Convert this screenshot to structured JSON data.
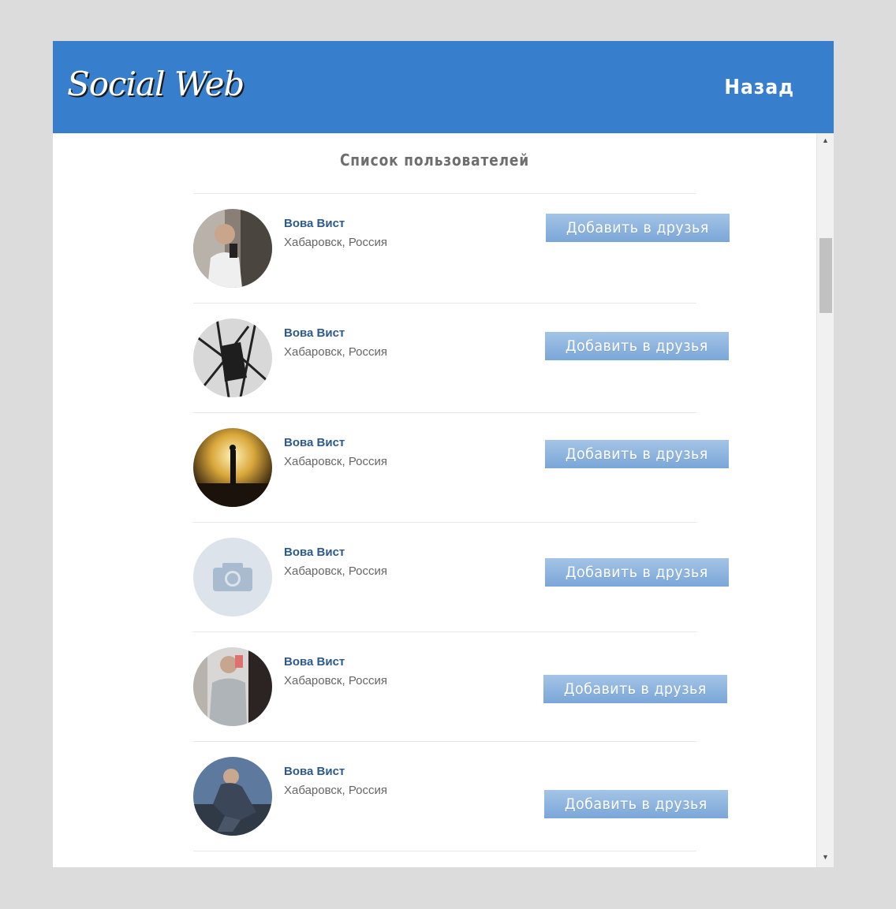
{
  "header": {
    "logo": "Social Web",
    "back_label": "Назад",
    "color": "#377ecc"
  },
  "page": {
    "title": "Список пользователей"
  },
  "users": [
    {
      "name": "Вова Вист",
      "location": "Хабаровск, Россия",
      "button_label": "Добавить в друзья",
      "avatar": "photo-man-mirror-selfie"
    },
    {
      "name": "Вова Вист",
      "location": "Хабаровск, Россия",
      "button_label": "Добавить в друзья",
      "avatar": "photo-dark-branches"
    },
    {
      "name": "Вова Вист",
      "location": "Хабаровск, Россия",
      "button_label": "Добавить в друзья",
      "avatar": "photo-silhouette-sunset"
    },
    {
      "name": "Вова Вист",
      "location": "Хабаровск, Россия",
      "button_label": "Добавить в друзья",
      "avatar": "camera-placeholder-icon"
    },
    {
      "name": "Вова Вист",
      "location": "Хабаровск, Россия",
      "button_label": "Добавить в друзья",
      "avatar": "photo-man-mirror-selfie"
    },
    {
      "name": "Вова Вист",
      "location": "Хабаровск, Россия",
      "button_label": "Добавить в друзья",
      "avatar": "photo-man-sitting"
    }
  ],
  "scrollbar": {
    "up_icon": "arrow-up-icon",
    "down_icon": "arrow-down-icon"
  }
}
